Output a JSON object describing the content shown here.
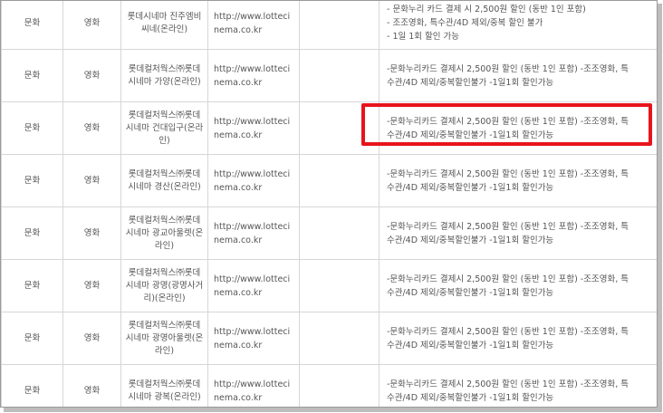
{
  "highlight_color": "#e8141c",
  "rows": [
    {
      "category": "문화",
      "type": "영화",
      "name": "롯데시네마 진주엠비씨네(온라인)",
      "url": "http://www.lottecinema.co.kr",
      "note": [
        "- 문화누리 카드 결제 시 2,500원 할인 (동반 1인 포함)",
        "- 조조영화, 특수관/4D 제외/중복 할인 불가",
        "- 1일 1회 할인 가능"
      ]
    },
    {
      "category": "문화",
      "type": "영화",
      "name": "롯데컬처웍스㈜롯데시네마 가양(온라인)",
      "url": "http://www.lottecinema.co.kr",
      "note": [
        "-문화누리카드 결제시 2,500원 할인 (동반 1인 포함) -조조영화, 특",
        "수관/4D 제외/중복할인불가 -1일1회 할인가능"
      ]
    },
    {
      "category": "문화",
      "type": "영화",
      "name": "롯데컬처웍스㈜롯데시네마 건대입구(온라인)",
      "url": "http://www.lottecinema.co.kr",
      "note": [
        "-문화누리카드 결제시 2,500원 할인 (동반 1인 포함) -조조영화, 특",
        "수관/4D 제외/중복할인불가 -1일1회 할인가능"
      ]
    },
    {
      "category": "문화",
      "type": "영화",
      "name": "롯데컬처웍스㈜롯데시네마 경산(온라인)",
      "url": "http://www.lottecinema.co.kr",
      "note": [
        "-문화누리카드 결제시 2,500원 할인 (동반 1인 포함) -조조영화, 특",
        "수관/4D 제외/중복할인불가 -1일1회 할인가능"
      ]
    },
    {
      "category": "문화",
      "type": "영화",
      "name": "롯데컬처웍스㈜롯데시네마 광교아울렛(온라인)",
      "url": "http://www.lottecinema.co.kr",
      "note": [
        "-문화누리카드 결제시 2,500원 할인 (동반 1인 포함) -조조영화, 특",
        "수관/4D 제외/중복할인불가 -1일1회 할인가능"
      ]
    },
    {
      "category": "문화",
      "type": "영화",
      "name": "롯데컬처웍스㈜롯데시네마 광명(광명사거리)(온라인)",
      "url": "http://www.lottecinema.co.kr",
      "note": [
        "-문화누리카드 결제시 2,500원 할인 (동반 1인 포함) -조조영화, 특",
        "수관/4D 제외/중복할인불가 -1일1회 할인가능"
      ]
    },
    {
      "category": "문화",
      "type": "영화",
      "name": "롯데컬처웍스㈜롯데시네마 광명아울렛(온라인)",
      "url": "http://www.lottecinema.co.kr",
      "note": [
        "-문화누리카드 결제시 2,500원 할인 (동반 1인 포함) -조조영화, 특",
        "수관/4D 제외/중복할인불가 -1일1회 할인가능"
      ]
    },
    {
      "category": "문화",
      "type": "영화",
      "name": "롯데컬처웍스㈜롯데시네마 광복(온라인)",
      "url": "http://www.lottecinema.co.kr",
      "note": [
        "-문화누리카드 결제시 2,500원 할인 (동반 1인 포함) -조조영화, 특",
        "수관/4D 제외/중복할인불가 -1일1회 할인가능"
      ]
    }
  ]
}
